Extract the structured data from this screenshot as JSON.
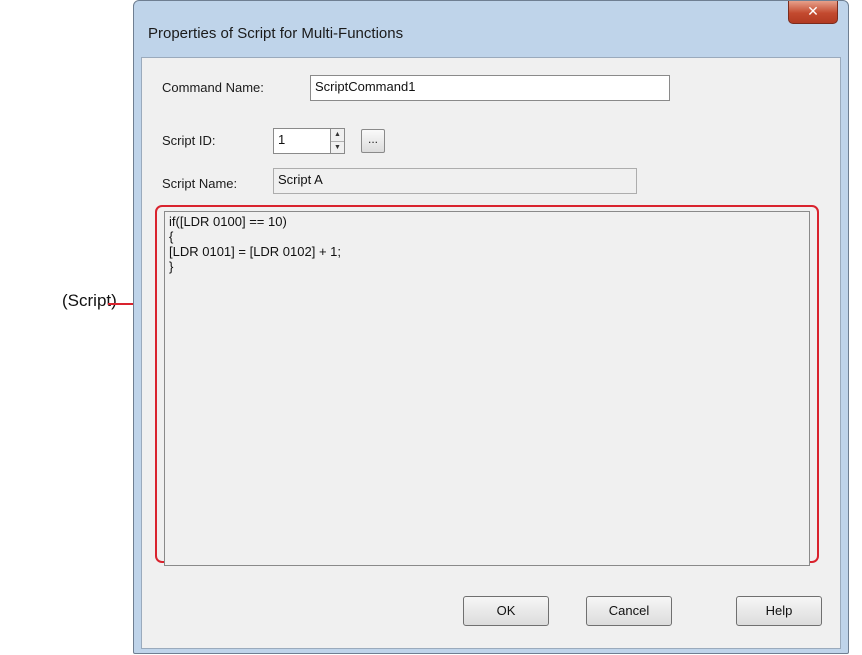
{
  "dialog": {
    "title": "Properties of Script for Multi-Functions",
    "close_icon": "close-icon",
    "close_glyph": "✕"
  },
  "command_name": {
    "label": "Command Name:",
    "value": "ScriptCommand1"
  },
  "script_id": {
    "label": "Script ID:",
    "value": "1",
    "browse_label": "..."
  },
  "script_name": {
    "label": "Script Name:",
    "value": "Script A"
  },
  "script": {
    "lines": [
      "if([LDR 0100] == 10)",
      "{",
      "[LDR 0101] = [LDR 0102] + 1;",
      "}"
    ]
  },
  "buttons": {
    "ok": "OK",
    "cancel": "Cancel",
    "help": "Help"
  },
  "callout": {
    "label": "(Script)"
  },
  "colors": {
    "highlight": "#d9232e",
    "dialog_frame": "#bfd4ea",
    "client_bg": "#f0f0f0"
  }
}
